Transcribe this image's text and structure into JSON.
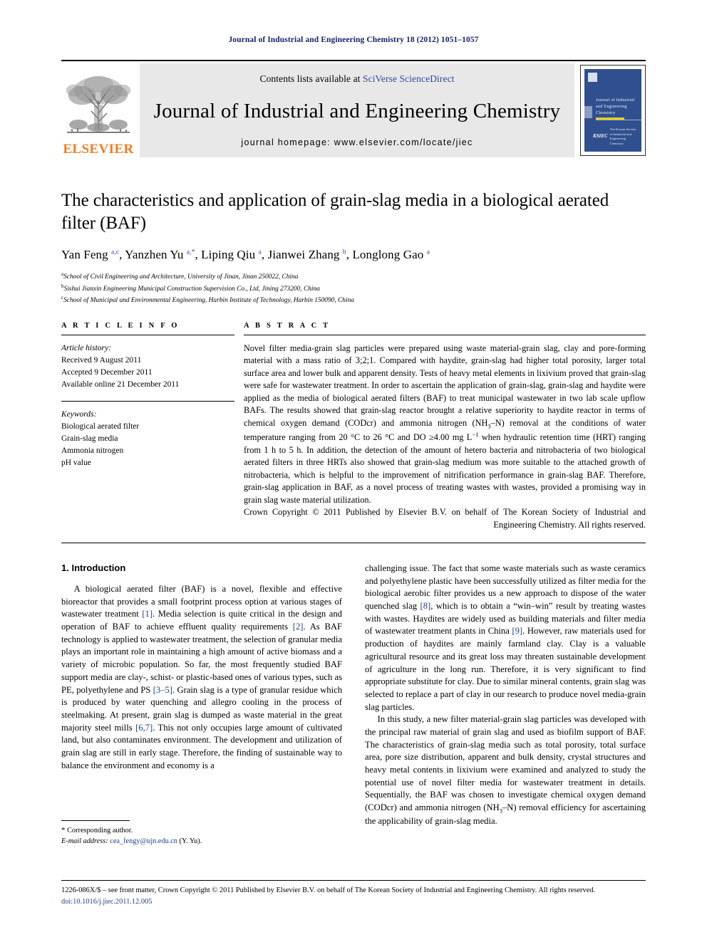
{
  "running_head": "Journal of Industrial and Engineering Chemistry 18 (2012) 1051–1057",
  "masthead": {
    "contents_prefix": "Contents lists available at ",
    "contents_link": "SciVerse ScienceDirect",
    "journal_title": "Journal of Industrial and Engineering Chemistry",
    "homepage": "journal homepage: www.elsevier.com/locate/jiec",
    "publisher_wordmark": "ELSEVIER",
    "cover": {
      "title_lines": "Journal of Industrial and Engineering Chemistry",
      "footer_text": "The Korean Society of Industrial and Engineering Chemistry",
      "footer_logo": "KSIEC"
    }
  },
  "article": {
    "title": "The characteristics and application of grain-slag media in a biological aerated filter (BAF)",
    "authors_html": "Yan Feng <sup>a,c</sup>, Yanzhen Yu <sup>a,*</sup>, Liping Qiu <sup>a</sup>, Jianwei Zhang <sup>b</sup>, Longlong Gao <sup>a</sup>",
    "affiliations": [
      {
        "mark": "a",
        "text": "School of Civil Engineering and Architecture, University of Jinan, Jinan 250022, China"
      },
      {
        "mark": "b",
        "text": "Sishui Jianxin Engineering Municipal Construction Supervision Co., Ltd, Jining 273200, China"
      },
      {
        "mark": "c",
        "text": "School of Municipal and Environmental Engineering, Harbin Institute of Technology, Harbin 150090, China"
      }
    ]
  },
  "info": {
    "section_label": "A R T I C L E   I N F O",
    "history_header": "Article history:",
    "history_lines": [
      "Received 9 August 2011",
      "Accepted 9 December 2011",
      "Available online 21 December 2011"
    ],
    "keywords_header": "Keywords:",
    "keywords": [
      "Biological aerated filter",
      "Grain-slag media",
      "Ammonia nitrogen",
      "pH value"
    ]
  },
  "abstract": {
    "section_label": "A B S T R A C T",
    "body_html": "Novel filter media-grain slag particles were prepared using waste material-grain slag, clay and pore-forming material with a mass ratio of 3;2;1. Compared with haydite, grain-slag had higher total porosity, larger total surface area and lower bulk and apparent density. Tests of heavy metal elements in lixivium proved that grain-slag were safe for wastewater treatment. In order to ascertain the application of grain-slag, grain-slag and haydite were applied as the media of biological aerated filters (BAF) to treat municipal wastewater in two lab scale upflow BAFs. The results showed that grain-slag reactor brought a relative superiority to haydite reactor in terms of chemical oxygen demand (CODcr) and ammonia nitrogen (NH<sub>3</sub>&#8211;N) removal at the conditions of water temperature ranging from 20 &#176;C to 26 &#176;C and DO &#8805;4.00 mg L<sup>&#8722;1</sup> when hydraulic retention time (HRT) ranging from 1 h to 5 h. In addition, the detection of the amount of hetero bacteria and nitrobacteria of two biological aerated filters in three HRTs also showed that grain-slag medium was more suitable to the attached growth of nitrobacteria, which is helpful to the improvement of nitrification performance in grain-slag BAF. Therefore, grain-slag application in BAF, as a novel process of treating wastes with wastes, provided a promising way in grain slag waste material utilization.",
    "copyright": "Crown Copyright © 2011 Published by Elsevier B.V. on behalf of The Korean Society of Industrial and Engineering Chemistry. All rights reserved."
  },
  "introduction": {
    "heading": "1.  Introduction",
    "left_paragraphs_html": [
      "A biological aerated filter (BAF) is a novel, flexible and effective bioreactor that provides a small footprint process option at various stages of wastewater treatment <span class=\"ref\">[1]</span>. Media selection is quite critical in the design and operation of BAF to achieve effluent quality requirements <span class=\"ref\">[2]</span>. As BAF technology is applied to wastewater treatment, the selection of granular media plays an important role in maintaining a high amount of active biomass and a variety of microbic population. So far, the most frequently studied BAF support media are clay-, schist- or plastic-based ones of various types, such as PE, polyethylene and PS <span class=\"ref\">[3&#8211;5]</span>. Grain slag is a type of granular residue which is produced by water quenching and allegro cooling in the process of steelmaking. At present, grain slag is dumped as waste material in the great majority steel mills <span class=\"ref\">[6,7]</span>. This not only occupies large amount of cultivated land, but also contaminates environment. The development and utilization of grain slag are still in early stage. Therefore, the finding of sustainable way to balance the environment and economy is a"
    ],
    "right_paragraphs_html": [
      "challenging issue. The fact that some waste materials such as waste ceramics and polyethylene plastic have been successfully utilized as filter media for the biological aerobic filter provides us a new approach to dispose of the water quenched slag <span class=\"ref\">[8]</span>, which is to obtain a &#8220;win&#8211;win&#8221; result by treating wastes with wastes. Haydites are widely used as building materials and filter media of wastewater treatment plants in China <span class=\"ref\">[9]</span>. However, raw materials used for production of haydites are mainly farmland clay. Clay is a valuable agricultural resource and its great loss may threaten sustainable development of agriculture in the long run. Therefore, it is very significant to find appropriate substitute for clay. Due to similar mineral contents, grain slag was selected to replace a part of clay in our research to produce novel media-grain slag particles.",
      "In this study, a new filter material-grain slag particles was developed with the principal raw material of grain slag and used as biofilm support of BAF. The characteristics of grain-slag media such as total porosity, total surface area, pore size distribution, apparent and bulk density, crystal structures and heavy metal contents in lixivium were examined and analyzed to study the potential use of novel filter media for wastewater treatment in details. Sequentially, the BAF was chosen to investigate chemical oxygen demand (CODcr) and ammonia nitrogen (NH<sub>3</sub>&#8211;N) removal efficiency for ascertaining the applicability of grain-slag media."
    ]
  },
  "footnote": {
    "corresponding_author": "Corresponding author.",
    "email_label": "E-mail address:",
    "email": "cea_fengy@ujn.edu.cn",
    "email_suffix": "(Y. Yu)."
  },
  "footer": {
    "copyright_line": "1226-086X/$ – see front matter, Crown Copyright © 2011 Published by Elsevier B.V. on behalf of The Korean Society of Industrial and Engineering Chemistry. All rights reserved.",
    "doi_label": "doi:",
    "doi": "10.1016/j.jiec.2011.12.005"
  },
  "colors": {
    "running_head": "#19216c",
    "link": "#2b4a9b",
    "reference": "#1f3e8c",
    "elsevier_orange": "#ef7d22",
    "cover_blue": "#2f4f8f"
  }
}
